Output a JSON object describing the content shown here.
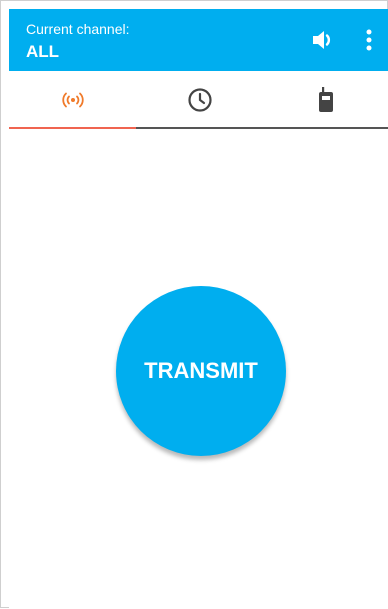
{
  "header": {
    "caption": "Current channel:",
    "channel": "ALL",
    "background": "#00aeef",
    "volume_icon": "volume-icon",
    "menu_icon": "more-vert-icon"
  },
  "tabs": [
    {
      "name": "broadcast",
      "icon": "broadcast-icon",
      "active": true,
      "color": "#f07a2a"
    },
    {
      "name": "history",
      "icon": "clock-icon",
      "active": false
    },
    {
      "name": "devices",
      "icon": "walkie-talkie-icon",
      "active": false
    }
  ],
  "tab_indicator_color": "#f06450",
  "main": {
    "transmit_label": "TRANSMIT",
    "button_color": "#00aeef"
  }
}
